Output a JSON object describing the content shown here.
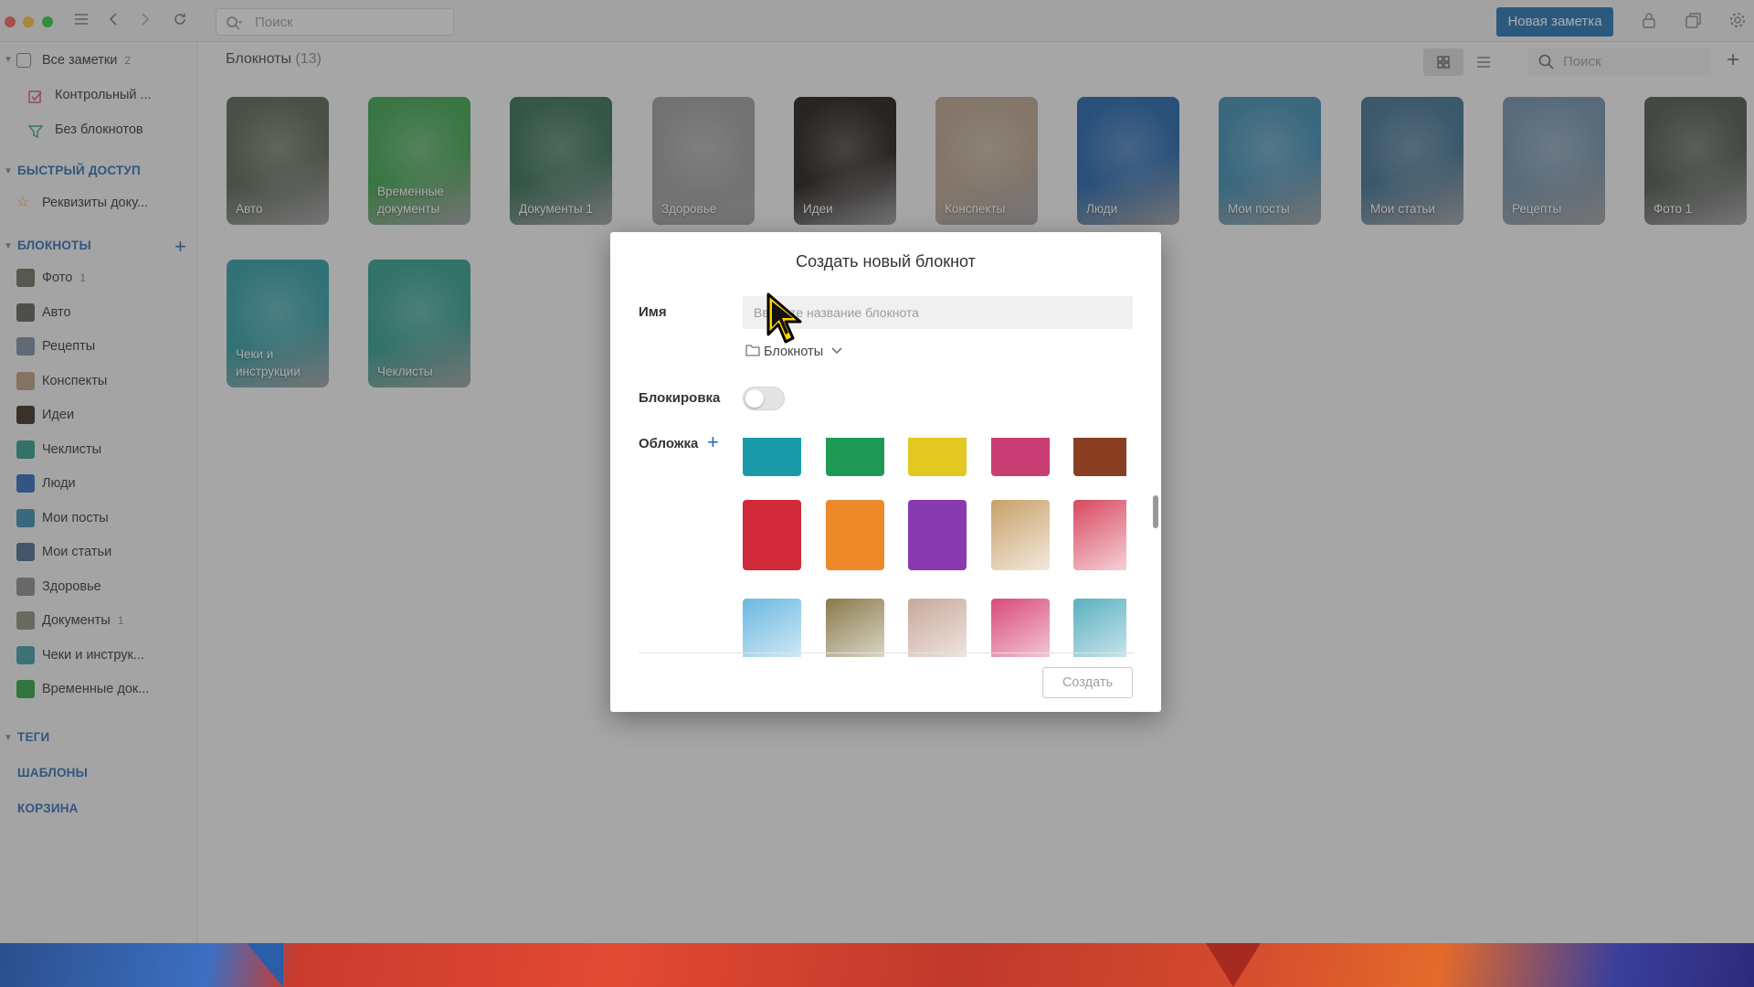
{
  "toolbar": {
    "search_placeholder": "Поиск",
    "new_note_label": "Новая заметка"
  },
  "sidebar": {
    "all_notes": {
      "label": "Все заметки",
      "count": "2"
    },
    "checklist_item": "Контрольный ...",
    "no_notebooks": "Без блокнотов",
    "quick_access_header": "БЫСТРЫЙ ДОСТУП",
    "quick_access_item": "Реквизиты доку...",
    "notebooks_header": "БЛОКНОТЫ",
    "notebooks": [
      {
        "label": "Фото",
        "count": "1",
        "color": "#6b6b5a"
      },
      {
        "label": "Авто",
        "count": "",
        "color": "#5a5f55"
      },
      {
        "label": "Рецепты",
        "count": "",
        "color": "#7a8aa0"
      },
      {
        "label": "Конспекты",
        "count": "",
        "color": "#b89a80"
      },
      {
        "label": "Идеи",
        "count": "",
        "color": "#3a2a1a"
      },
      {
        "label": "Чеклисты",
        "count": "",
        "color": "#2e9a8c"
      },
      {
        "label": "Люди",
        "count": "",
        "color": "#2a6ab8"
      },
      {
        "label": "Мои посты",
        "count": "",
        "color": "#3a8ab0"
      },
      {
        "label": "Мои статьи",
        "count": "",
        "color": "#4a6a8a"
      },
      {
        "label": "Здоровье",
        "count": "",
        "color": "#888888"
      },
      {
        "label": "Документы",
        "count": "1",
        "color": "#8a8a7a"
      },
      {
        "label": "Чеки и инструк...",
        "count": "",
        "color": "#3a9aa0"
      },
      {
        "label": "Временные док...",
        "count": "",
        "color": "#2aa040"
      }
    ],
    "tags_header": "ТЕГИ",
    "templates_header": "ШАБЛОНЫ",
    "trash_header": "КОРЗИНА"
  },
  "main": {
    "title": "Блокноты",
    "count": "(13)",
    "search_placeholder": "Поиск",
    "notebooks": [
      {
        "label": "Авто",
        "color": "#56604f"
      },
      {
        "label": "Временные документы",
        "color": "#3aa04a"
      },
      {
        "label": "Документы 1",
        "color": "#2d6a50"
      },
      {
        "label": "Здоровье",
        "color": "#9a9a9a"
      },
      {
        "label": "Идеи",
        "color": "#1a1410"
      },
      {
        "label": "Конспекты",
        "color": "#b8a08a"
      },
      {
        "label": "Люди",
        "color": "#1c5fa8"
      },
      {
        "label": "Мои посты",
        "color": "#3a88b0"
      },
      {
        "label": "Мои статьи",
        "color": "#3a6e8e"
      },
      {
        "label": "Рецепты",
        "color": "#6e8ea8"
      },
      {
        "label": "Фото 1",
        "color": "#4a5248"
      },
      {
        "label": "Чеки и инструкции",
        "color": "#2a9aa2"
      },
      {
        "label": "Чеклисты",
        "color": "#2a9a8a"
      }
    ]
  },
  "dialog": {
    "title": "Создать новый блокнот",
    "name_label": "Имя",
    "name_placeholder": "Введите название блокнота",
    "name_value": "",
    "folder_value": "Блокноты",
    "lock_label": "Блокировка",
    "lock_on": false,
    "cover_label": "Обложка",
    "create_label": "Создать",
    "covers": [
      {
        "name": "teal",
        "color": "#1a9aa8"
      },
      {
        "name": "green",
        "color": "#1e9a55"
      },
      {
        "name": "yellow",
        "color": "#e2c820"
      },
      {
        "name": "pink",
        "color": "#c83e72"
      },
      {
        "name": "brown",
        "color": "#8a3e22"
      },
      {
        "name": "red",
        "color": "#d22a3a"
      },
      {
        "name": "orange",
        "color": "#ec8a2a"
      },
      {
        "name": "purple",
        "color": "#8a3ab0"
      },
      {
        "name": "owl-image",
        "color": "#c8a068"
      },
      {
        "name": "paper-plane-image",
        "color": "#d84860"
      },
      {
        "name": "water-image",
        "color": "#6ab8e0"
      },
      {
        "name": "autumn-image",
        "color": "#8a7a4a"
      },
      {
        "name": "london-image",
        "color": "#c8a89a"
      },
      {
        "name": "flowers-image",
        "color": "#d84a7a"
      },
      {
        "name": "sky-image",
        "color": "#5ab0c0"
      }
    ]
  }
}
